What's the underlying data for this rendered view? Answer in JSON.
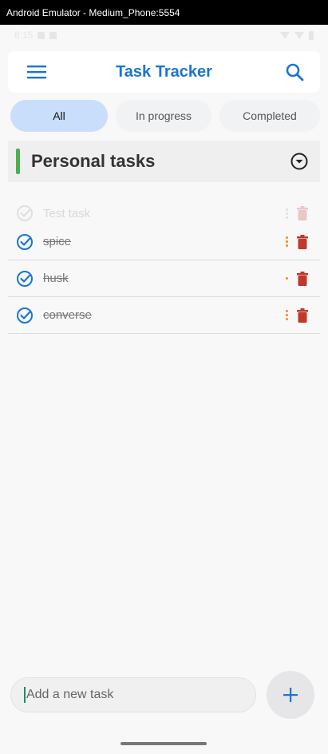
{
  "window": {
    "title": "Android Emulator - Medium_Phone:5554"
  },
  "status_bar": {
    "time": "8:15"
  },
  "app_bar": {
    "title": "Task Tracker",
    "menu_icon": "menu-icon",
    "search_icon": "search-icon"
  },
  "filters": [
    {
      "label": "All",
      "active": true
    },
    {
      "label": "In progress",
      "active": false
    },
    {
      "label": "Completed",
      "active": false
    }
  ],
  "section": {
    "title": "Personal tasks",
    "accent_color": "#4caf50",
    "toggle_icon": "chevron-down-circle-icon"
  },
  "tasks": {
    "ghost": {
      "label": "Test task"
    },
    "items": [
      {
        "label": "spice",
        "completed": true
      },
      {
        "label": "husk",
        "completed": true
      },
      {
        "label": "converse",
        "completed": true
      }
    ]
  },
  "composer": {
    "placeholder": "Add a new task",
    "value": ""
  },
  "colors": {
    "brand": "#1976d2",
    "chip_active": "#c9defb",
    "delete": "#c0392b",
    "more": "#f09020"
  }
}
